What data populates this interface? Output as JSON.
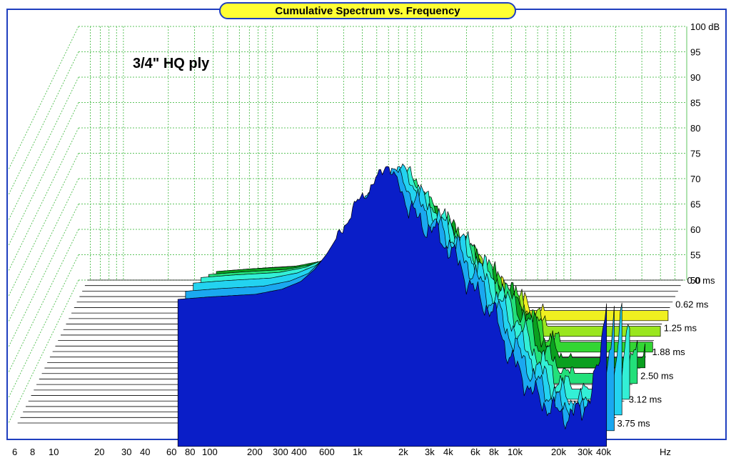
{
  "chart_data": {
    "type": "area",
    "subtype": "cumulative-spectral-decay-waterfall",
    "title": "Cumulative Spectrum vs. Frequency",
    "annotation": "3/4\" HQ ply",
    "x_scale": "log",
    "x_unit": "Hz",
    "x_ticks": [
      "6",
      "8",
      "10",
      "20",
      "30",
      "40",
      "60",
      "80",
      "100",
      "200",
      "300",
      "400",
      "600",
      "1k",
      "2k",
      "3k",
      "4k",
      "6k",
      "8k",
      "10k",
      "20k",
      "30k",
      "40k"
    ],
    "y_unit": "dB",
    "y_ticks": [
      "100 dB",
      "95",
      "90",
      "85",
      "80",
      "75",
      "70",
      "65",
      "60",
      "55",
      "50"
    ],
    "ylim": [
      50,
      100
    ],
    "z_unit": "ms",
    "z_ticks": [
      "0.0 ms",
      "0.62 ms",
      "1.25 ms",
      "1.88 ms",
      "2.50 ms",
      "3.12 ms",
      "3.75 ms"
    ],
    "zlim": [
      0,
      3.75
    ],
    "slice_frequency_range_hz": [
      60,
      45000
    ],
    "slices": [
      {
        "time_ms": 0.0,
        "values": [
          [
            60,
            71
          ],
          [
            100,
            71.5
          ],
          [
            200,
            72
          ],
          [
            300,
            73
          ],
          [
            400,
            74.5
          ],
          [
            500,
            77
          ],
          [
            600,
            80
          ],
          [
            800,
            86
          ],
          [
            1000,
            91
          ],
          [
            1200,
            93
          ],
          [
            1500,
            98
          ],
          [
            1700,
            95
          ],
          [
            2000,
            91
          ],
          [
            2500,
            86
          ],
          [
            3000,
            85
          ],
          [
            4000,
            81
          ],
          [
            5000,
            76
          ],
          [
            6000,
            72
          ],
          [
            8000,
            68
          ],
          [
            10000,
            60
          ],
          [
            12000,
            56
          ],
          [
            15000,
            52
          ],
          [
            20000,
            49
          ],
          [
            25000,
            48
          ],
          [
            30000,
            49
          ],
          [
            35000,
            52
          ],
          [
            40000,
            58
          ],
          [
            45000,
            72
          ]
        ]
      },
      {
        "time_ms": 0.31,
        "values": [
          [
            60,
            69.5
          ],
          [
            100,
            70
          ],
          [
            200,
            70.5
          ],
          [
            300,
            71.5
          ],
          [
            400,
            73
          ],
          [
            600,
            78
          ],
          [
            800,
            84
          ],
          [
            1000,
            89
          ],
          [
            1500,
            94
          ],
          [
            2000,
            88
          ],
          [
            3000,
            82
          ],
          [
            4000,
            78
          ],
          [
            6000,
            70
          ],
          [
            8000,
            64
          ],
          [
            10000,
            58
          ],
          [
            15000,
            50
          ],
          [
            20000,
            47
          ],
          [
            30000,
            46
          ],
          [
            40000,
            54
          ],
          [
            45000,
            66
          ]
        ]
      },
      {
        "time_ms": 0.62,
        "values": [
          [
            60,
            68
          ],
          [
            100,
            68.5
          ],
          [
            200,
            69
          ],
          [
            300,
            70
          ],
          [
            400,
            71.5
          ],
          [
            600,
            76
          ],
          [
            800,
            82
          ],
          [
            1000,
            87
          ],
          [
            1500,
            91
          ],
          [
            2000,
            85
          ],
          [
            3000,
            79
          ],
          [
            4000,
            75
          ],
          [
            6000,
            67
          ],
          [
            8000,
            61
          ],
          [
            10000,
            55
          ],
          [
            15000,
            48
          ],
          [
            20000,
            45
          ],
          [
            30000,
            44
          ],
          [
            40000,
            51
          ],
          [
            45000,
            62
          ]
        ]
      },
      {
        "time_ms": 0.94,
        "values": [
          [
            60,
            66
          ],
          [
            100,
            66.5
          ],
          [
            200,
            67
          ],
          [
            300,
            68
          ],
          [
            400,
            69.5
          ],
          [
            600,
            74
          ],
          [
            800,
            79
          ],
          [
            1000,
            83
          ],
          [
            1500,
            87
          ],
          [
            2000,
            81
          ],
          [
            3000,
            75
          ],
          [
            4000,
            71
          ],
          [
            6000,
            64
          ],
          [
            8000,
            58
          ],
          [
            10000,
            52
          ],
          [
            15000,
            46
          ],
          [
            20000,
            43
          ],
          [
            30000,
            42
          ],
          [
            40000,
            47
          ],
          [
            45000,
            57
          ]
        ]
      },
      {
        "time_ms": 1.25,
        "values": [
          [
            60,
            63.5
          ],
          [
            100,
            64
          ],
          [
            200,
            64.5
          ],
          [
            300,
            65.5
          ],
          [
            400,
            67
          ],
          [
            600,
            71
          ],
          [
            800,
            75
          ],
          [
            1000,
            79
          ],
          [
            1500,
            82
          ],
          [
            2000,
            76
          ],
          [
            3000,
            70
          ],
          [
            4000,
            66
          ],
          [
            6000,
            60
          ],
          [
            8000,
            55
          ],
          [
            10000,
            49
          ],
          [
            15000,
            44
          ],
          [
            20000,
            41
          ],
          [
            30000,
            40
          ],
          [
            40000,
            44
          ],
          [
            45000,
            52
          ]
        ]
      },
      {
        "time_ms": 1.56,
        "values": [
          [
            60,
            61
          ],
          [
            100,
            61.5
          ],
          [
            200,
            62
          ],
          [
            300,
            63
          ],
          [
            400,
            64
          ],
          [
            600,
            67
          ],
          [
            800,
            70
          ],
          [
            1000,
            73
          ],
          [
            1500,
            76
          ],
          [
            2000,
            71
          ],
          [
            3000,
            65
          ],
          [
            4000,
            61
          ],
          [
            6000,
            56
          ],
          [
            8000,
            51
          ],
          [
            10000,
            47
          ],
          [
            15000,
            42
          ],
          [
            20000,
            39
          ],
          [
            30000,
            38
          ],
          [
            40000,
            41
          ],
          [
            45000,
            47
          ]
        ]
      },
      {
        "time_ms": 1.88,
        "values": [
          [
            60,
            58
          ],
          [
            100,
            58.5
          ],
          [
            200,
            59
          ],
          [
            300,
            60
          ],
          [
            400,
            61
          ],
          [
            600,
            63
          ],
          [
            800,
            65
          ],
          [
            1000,
            68
          ],
          [
            1500,
            70
          ],
          [
            2000,
            65
          ],
          [
            3000,
            60
          ],
          [
            4000,
            56
          ],
          [
            6000,
            51
          ],
          [
            8000,
            47
          ],
          [
            10000,
            44
          ],
          [
            15000,
            40
          ],
          [
            20000,
            37
          ],
          [
            30000,
            36
          ],
          [
            40000,
            38
          ],
          [
            45000,
            43
          ]
        ]
      },
      {
        "time_ms": 2.19,
        "values": [
          [
            60,
            55
          ],
          [
            100,
            55.5
          ],
          [
            200,
            56
          ],
          [
            300,
            56.5
          ],
          [
            400,
            57.5
          ],
          [
            600,
            59
          ],
          [
            800,
            61
          ],
          [
            1000,
            63
          ],
          [
            1500,
            64
          ],
          [
            2000,
            60
          ],
          [
            3000,
            55
          ],
          [
            4000,
            51
          ],
          [
            6000,
            47
          ],
          [
            8000,
            44
          ],
          [
            10000,
            41
          ],
          [
            15000,
            38
          ],
          [
            20000,
            35
          ],
          [
            30000,
            34
          ],
          [
            40000,
            36
          ],
          [
            45000,
            40
          ]
        ]
      },
      {
        "time_ms": 2.5,
        "values": [
          [
            60,
            52
          ],
          [
            100,
            52.5
          ],
          [
            200,
            53
          ],
          [
            300,
            53.5
          ],
          [
            400,
            54
          ],
          [
            600,
            55
          ],
          [
            800,
            56.5
          ],
          [
            1000,
            58
          ],
          [
            1500,
            58
          ],
          [
            2000,
            54
          ],
          [
            3000,
            50
          ],
          [
            4000,
            47
          ],
          [
            6000,
            43
          ],
          [
            8000,
            40
          ],
          [
            10000,
            38
          ],
          [
            15000,
            35
          ],
          [
            20000,
            33
          ],
          [
            30000,
            32
          ],
          [
            40000,
            34
          ],
          [
            45000,
            37
          ]
        ]
      }
    ]
  },
  "colors": {
    "frame_border": "#1f3fbf",
    "title_fill": "#ffff33",
    "grid": "#5fc45f",
    "floor_lines": "#000000",
    "slice_palette": [
      "#0a1ec8",
      "#1aa8f0",
      "#23d3f0",
      "#33f0d6",
      "#22e07a",
      "#0aa020",
      "#33d633",
      "#9ae61e",
      "#f0f020"
    ],
    "ridge_palette": [
      "#8b0a0a",
      "#b22222",
      "#e05a10",
      "#f0a020",
      "#f0e020",
      "#9ae61e",
      "#33c633",
      "#1a9ef0",
      "#0a1ec8"
    ]
  }
}
